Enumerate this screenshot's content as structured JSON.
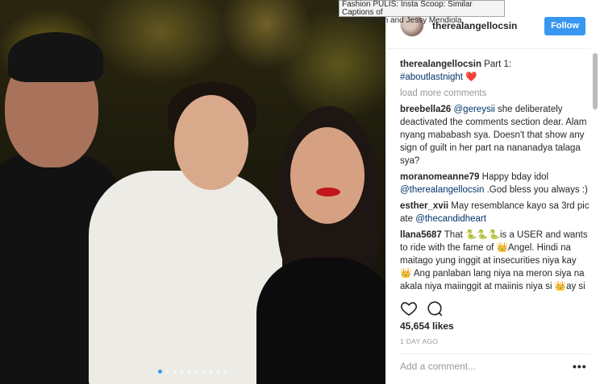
{
  "tooltip": {
    "line1": "Fashion PULIS: Insta Scoop: Similar Captions of",
    "line2": "Angel Locsin and Jessy Mendiola"
  },
  "photo": {
    "carousel_dots": 10,
    "active_dot": 0
  },
  "header": {
    "username": "therealangellocsin",
    "follow_label": "Follow"
  },
  "caption": {
    "user": "therealangellocsin",
    "text": " Part 1:",
    "hashtag": "#aboutlastnight",
    "heart": "❤️"
  },
  "load_more": "load more comments",
  "comments": [
    {
      "user": "breebella26",
      "mention": "@gereysii",
      "text": " she deliberately deactivated the comments section dear. Alam nyang mababash sya. Doesn't that show any sign of guilt in her part na nananadya talaga sya?"
    },
    {
      "user": "moranomeanne79",
      "text_before": " Happy bday idol ",
      "mention": "@therealangellocsin",
      "text_after": " .God bless you always :)"
    },
    {
      "user": "esther_xvii",
      "text_before": " May resemblance kayo sa 3rd pic ate ",
      "mention": "@thecandidheart"
    },
    {
      "user": "llana5687",
      "text1": " That ",
      "emoji1": "🐍🐍🐍",
      "text2": "is a USER and wants to ride with the fame of ",
      "emoji2": "👑",
      "text3": "Angel. Hindi na maitago yung inggit at insecurities niya kay ",
      "emoji3": "👑",
      "text4": " Ang panlaban lang niya na meron siya na akala niya maiinggit at maiinis niya si ",
      "emoji4": "👑",
      "text5": "ay si Luis"
    }
  ],
  "actions": {
    "likes": "45,654 likes",
    "timestamp": "1 DAY AGO",
    "add_comment_placeholder": "Add a comment...",
    "more_label": "•••"
  },
  "colors": {
    "accent": "#3897f0",
    "link": "#003569",
    "heart": "#ed4956"
  }
}
